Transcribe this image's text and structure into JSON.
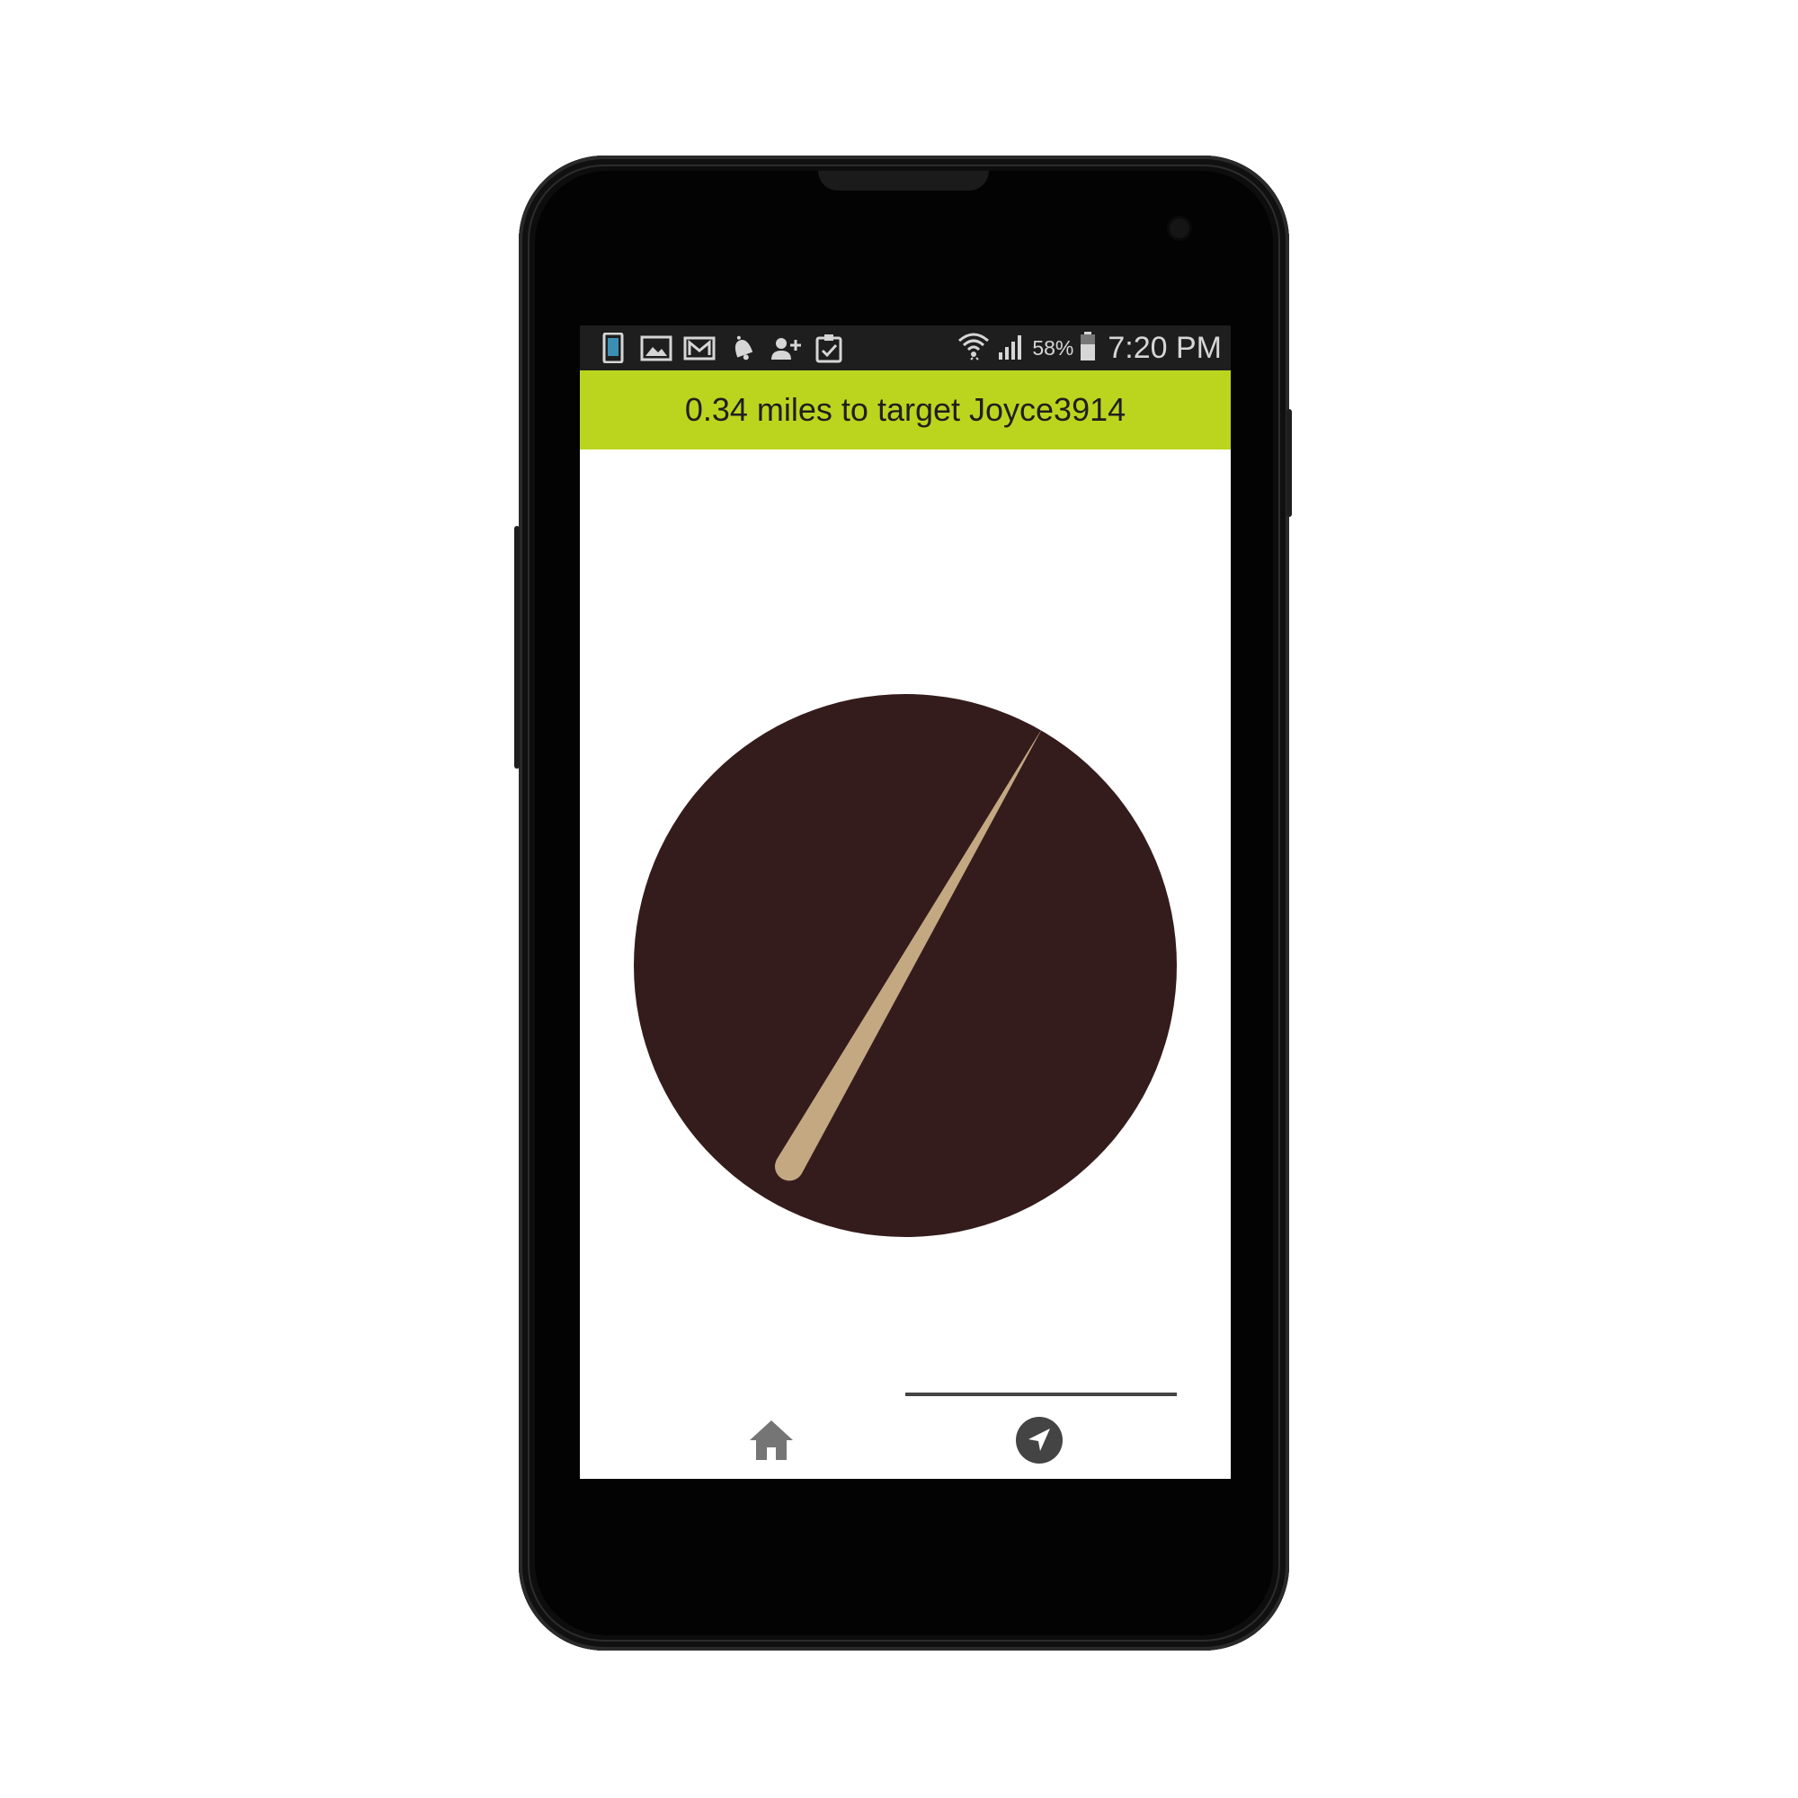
{
  "status_bar": {
    "notification_icons": [
      "phone-icon",
      "image-icon",
      "gmail-icon",
      "bell-icon",
      "add-user-icon",
      "clipboard-check-icon"
    ],
    "system_icons": [
      "wifi-icon",
      "signal-icon",
      "battery-icon"
    ],
    "battery_percent": "58%",
    "time": "7:20 PM"
  },
  "header": {
    "text": "0.34 miles to target Joyce3914",
    "background_color": "#bbd51f"
  },
  "compass": {
    "dial_color": "#341c1d",
    "needle_color": "#c4a882",
    "needle_heading_degrees": 30
  },
  "bottom_nav": {
    "items": [
      {
        "icon": "home-icon",
        "selected": false
      },
      {
        "icon": "navigation-arrow-icon",
        "selected": true
      }
    ],
    "indicator_color": "#444444"
  }
}
